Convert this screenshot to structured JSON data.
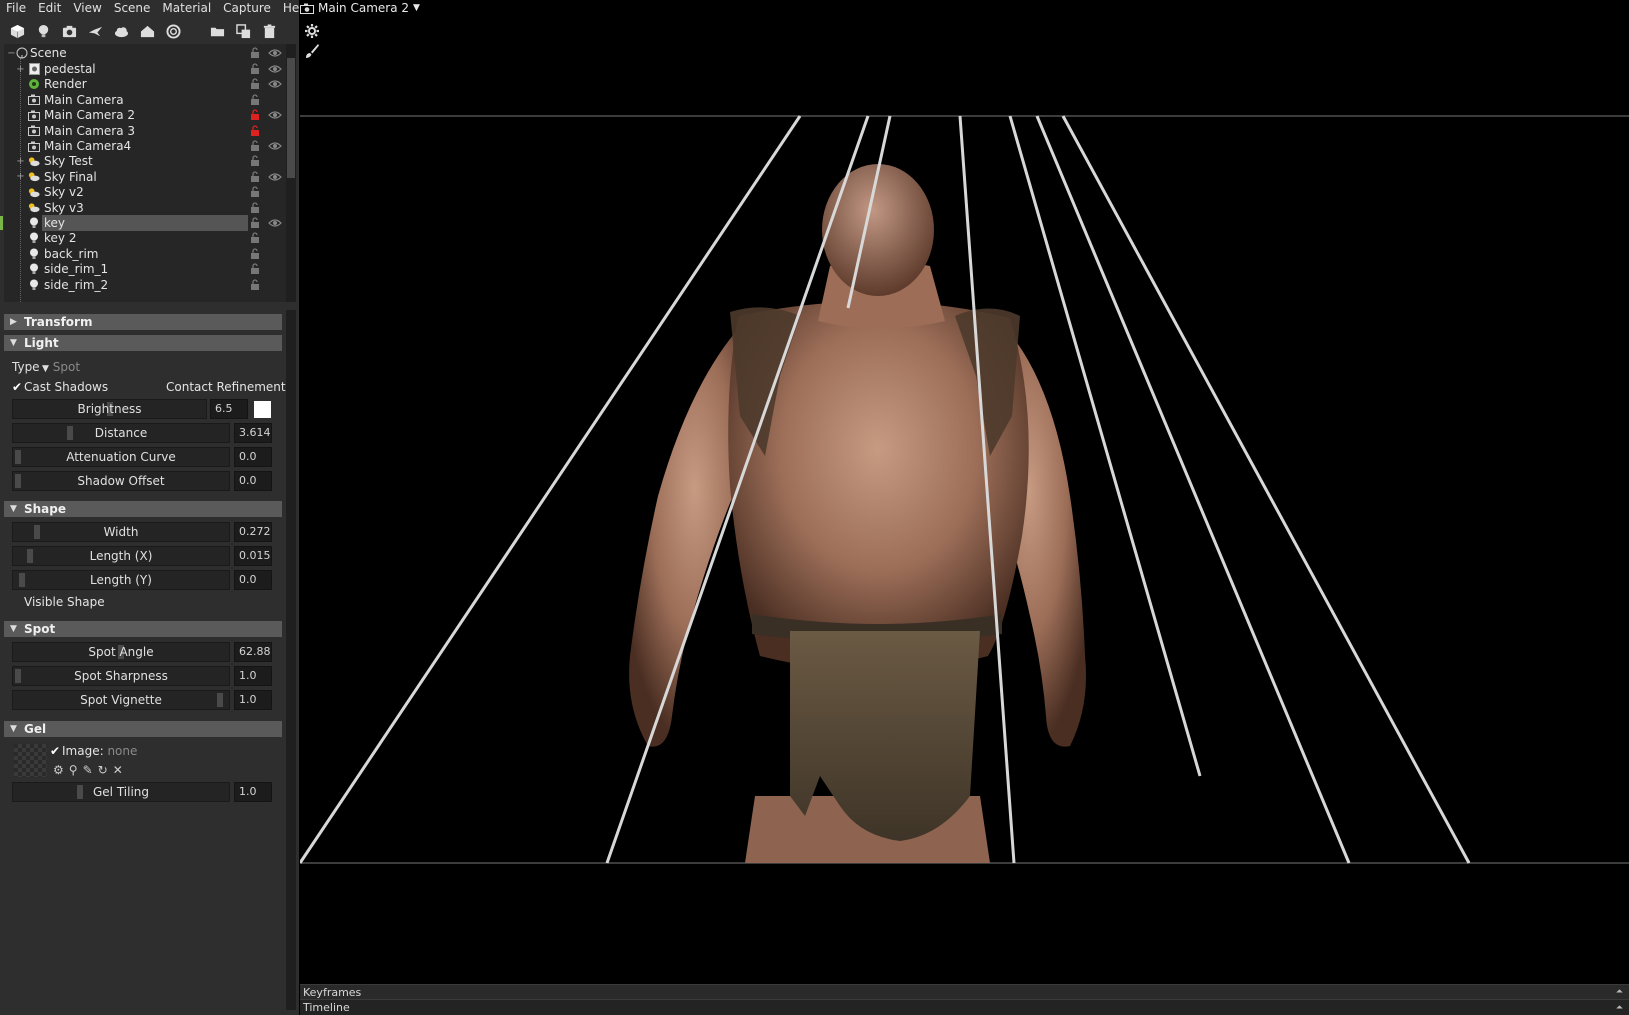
{
  "menu": [
    "File",
    "Edit",
    "View",
    "Scene",
    "Material",
    "Capture",
    "Help"
  ],
  "toolbar": {
    "icons": [
      "cube-icon",
      "bulb-icon",
      "camera-add-icon",
      "bird-icon",
      "sky-icon",
      "house-icon",
      "swirl-icon",
      "folder-icon",
      "duplicate-icon",
      "trash-icon"
    ]
  },
  "tree": {
    "root": "Scene",
    "items": [
      {
        "label": "pedestal",
        "icon": "mesh-icon",
        "expander": "+",
        "eye": true,
        "lock_red": false
      },
      {
        "label": "Render",
        "icon": "render-gear-icon",
        "expander": "",
        "eye": true,
        "lock_red": false
      },
      {
        "label": "Main Camera",
        "icon": "camera-icon",
        "expander": "",
        "eye": false,
        "lock_red": false
      },
      {
        "label": "Main Camera 2",
        "icon": "camera-icon",
        "expander": "",
        "eye": true,
        "lock_red": true
      },
      {
        "label": "Main Camera 3",
        "icon": "camera-icon",
        "expander": "",
        "eye": false,
        "lock_red": true
      },
      {
        "label": "Main Camera4",
        "icon": "camera-icon",
        "expander": "",
        "eye": true,
        "lock_red": false
      },
      {
        "label": "Sky Test",
        "icon": "sky-icon",
        "expander": "+",
        "eye": false,
        "lock_red": false
      },
      {
        "label": "Sky Final",
        "icon": "sky-icon",
        "expander": "+",
        "eye": true,
        "lock_red": false
      },
      {
        "label": "Sky v2",
        "icon": "sky-icon",
        "expander": "",
        "eye": false,
        "lock_red": false
      },
      {
        "label": "Sky v3",
        "icon": "sky-icon",
        "expander": "",
        "eye": false,
        "lock_red": false
      },
      {
        "label": "key",
        "icon": "light-icon",
        "expander": "",
        "eye": true,
        "lock_red": false,
        "selected": true
      },
      {
        "label": "key 2",
        "icon": "light-icon",
        "expander": "",
        "eye": false,
        "lock_red": false
      },
      {
        "label": "back_rim",
        "icon": "light-icon",
        "expander": "",
        "eye": false,
        "lock_red": false
      },
      {
        "label": "side_rim_1",
        "icon": "light-icon",
        "expander": "",
        "eye": false,
        "lock_red": false
      },
      {
        "label": "side_rim_2",
        "icon": "light-icon",
        "expander": "",
        "eye": false,
        "lock_red": false
      }
    ]
  },
  "sections": {
    "transform": "Transform",
    "light": "Light",
    "shape": "Shape",
    "spot": "Spot",
    "gel": "Gel"
  },
  "light": {
    "type_label": "Type",
    "type_value": "Spot",
    "cast_shadows": "Cast Shadows",
    "contact_refinement": "Contact Refinement",
    "brightness": {
      "label": "Brightness",
      "value": "6.5",
      "level": 0.5
    },
    "distance": {
      "label": "Distance",
      "value": "3.614",
      "level": 0.25
    },
    "attenuation": {
      "label": "Attenuation Curve",
      "value": "0.0",
      "level": 0.0
    },
    "shadow_offset": {
      "label": "Shadow Offset",
      "value": "0.0",
      "level": 0.0
    }
  },
  "shape": {
    "width": {
      "label": "Width",
      "value": "0.272",
      "level": 0.09
    },
    "length_x": {
      "label": "Length (X)",
      "value": "0.015",
      "level": 0.06
    },
    "length_y": {
      "label": "Length (Y)",
      "value": "0.0",
      "level": 0.02
    },
    "visible_shape": "Visible Shape"
  },
  "spot": {
    "angle": {
      "label": "Spot Angle",
      "value": "62.88",
      "level": 0.5
    },
    "sharpness": {
      "label": "Spot Sharpness",
      "value": "1.0",
      "level": 0.0
    },
    "vignette": {
      "label": "Spot Vignette",
      "value": "1.0",
      "level": 0.98
    }
  },
  "gel": {
    "image_label": "Image:",
    "image_value": "none",
    "tiling": {
      "label": "Gel Tiling",
      "value": "1.0",
      "level": 0.3
    }
  },
  "viewport": {
    "camera": "Main Camera 2"
  },
  "bottom": {
    "keyframes": "Keyframes",
    "timeline": "Timeline"
  }
}
